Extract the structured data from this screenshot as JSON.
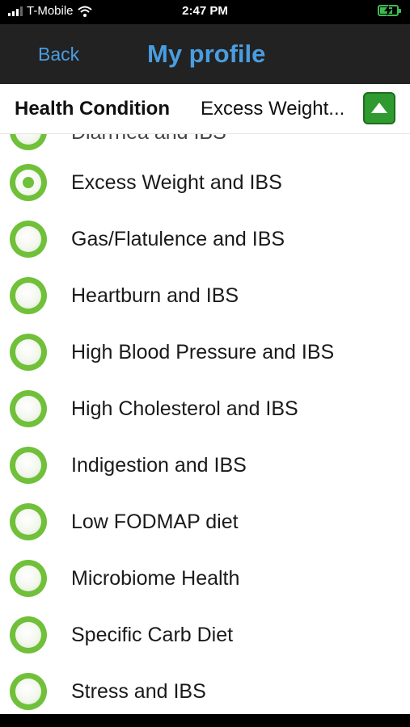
{
  "status_bar": {
    "carrier": "T-Mobile",
    "time": "2:47 PM",
    "signal_bars": 4,
    "signal_active": 3,
    "battery_level": 0.7,
    "battery_color": "#3fb950",
    "charging": true
  },
  "nav": {
    "back_label": "Back",
    "title": "My profile",
    "accent_color": "#4a9de0"
  },
  "condition": {
    "label": "Health Condition",
    "value": "Excess Weight...",
    "toggle_icon": "triangle-up-icon"
  },
  "options": [
    {
      "label": "Diarrhea and IBS",
      "selected": false,
      "partial": true
    },
    {
      "label": "Excess Weight and IBS",
      "selected": true
    },
    {
      "label": "Gas/Flatulence and IBS",
      "selected": false
    },
    {
      "label": "Heartburn and IBS",
      "selected": false
    },
    {
      "label": "High Blood Pressure and IBS",
      "selected": false
    },
    {
      "label": "High Cholesterol and IBS",
      "selected": false
    },
    {
      "label": "Indigestion and IBS",
      "selected": false
    },
    {
      "label": "Low FODMAP diet",
      "selected": false
    },
    {
      "label": "Microbiome Health",
      "selected": false
    },
    {
      "label": "Specific Carb Diet",
      "selected": false
    },
    {
      "label": "Stress and IBS",
      "selected": false
    }
  ],
  "colors": {
    "radio_green": "#70c03a",
    "button_green": "#2f9a2f"
  }
}
